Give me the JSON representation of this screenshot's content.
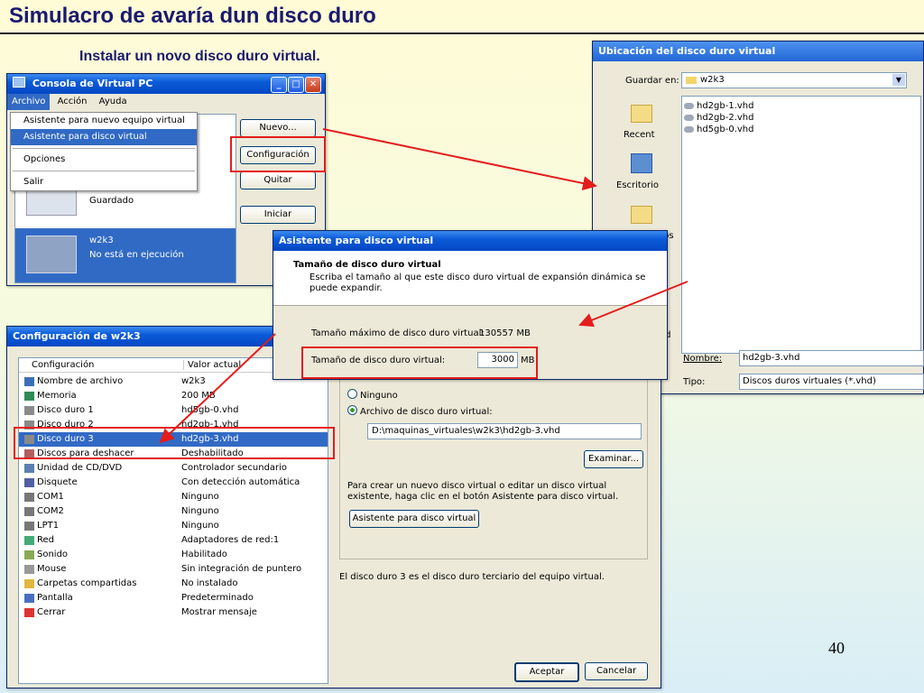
{
  "slide": {
    "title": "Simulacro de avaría dun disco duro",
    "subtitle": "Instalar un novo disco duro virtual.",
    "page_number": "40"
  },
  "console": {
    "title": "Consola de Virtual PC",
    "menu": [
      "Archivo",
      "Acción",
      "Ayuda"
    ],
    "dropdown": [
      "Asistente para nuevo equipo virtual",
      "Asistente para disco virtual",
      "Opciones",
      "Salir"
    ],
    "buttons": {
      "new": "Nuevo...",
      "settings": "Configuración",
      "remove": "Quitar",
      "start": "Iniciar"
    },
    "vm1_status": "Guardado",
    "vm2_name": "w2k3",
    "vm2_status": "No está en ejecución"
  },
  "save_dialog": {
    "title": "Ubicación del disco duro virtual",
    "save_in_label": "Guardar en:",
    "save_in_value": "w2k3",
    "places": [
      "Recent",
      "Escritorio",
      "ntos"
    ],
    "files": [
      "hd2gb-1.vhd",
      "hd2gb-2.vhd",
      "hd5gb-0.vhd"
    ],
    "name_label": "Nombre:",
    "name_value": "hd2gb-3.vhd",
    "type_label": "Tipo:",
    "type_value": "Discos duros virtuales (*.vhd)",
    "edge_fragment": "ed"
  },
  "wizard": {
    "title": "Asistente para disco virtual",
    "heading": "Tamaño de disco duro virtual",
    "description": "Escriba el tamaño al que este disco duro virtual de expansión dinámica se puede expandir.",
    "max_size_label": "Tamaño máximo de disco duro virtual:",
    "max_size_value": "130557 MB",
    "size_label": "Tamaño de disco duro virtual:",
    "size_value": "3000",
    "size_unit": "MB"
  },
  "config": {
    "title": "Configuración de w2k3",
    "col_setting": "Configuración",
    "col_value": "Valor actual",
    "rows": [
      {
        "k": "Nombre de archivo",
        "v": "w2k3"
      },
      {
        "k": "Memoria",
        "v": "200 MB"
      },
      {
        "k": "Disco duro 1",
        "v": "hd5gb-0.vhd"
      },
      {
        "k": "Disco duro 2",
        "v": "hd2gb-1.vhd"
      },
      {
        "k": "Disco duro 3",
        "v": "hd2gb-3.vhd"
      },
      {
        "k": "Discos para deshacer",
        "v": "Deshabilitado"
      },
      {
        "k": "Unidad de CD/DVD",
        "v": "Controlador secundario"
      },
      {
        "k": "Disquete",
        "v": "Con detección automática"
      },
      {
        "k": "COM1",
        "v": "Ninguno"
      },
      {
        "k": "COM2",
        "v": "Ninguno"
      },
      {
        "k": "LPT1",
        "v": "Ninguno"
      },
      {
        "k": "Red",
        "v": "Adaptadores de red:1"
      },
      {
        "k": "Sonido",
        "v": "Habilitado"
      },
      {
        "k": "Mouse",
        "v": "Sin integración de puntero"
      },
      {
        "k": "Carpetas compartidas",
        "v": "No instalado"
      },
      {
        "k": "Pantalla",
        "v": "Predeterminado"
      },
      {
        "k": "Cerrar",
        "v": "Mostrar mensaje"
      }
    ],
    "selected_index": 4,
    "option_none": "Ninguno",
    "option_file": "Archivo de disco duro virtual:",
    "file_path": "D:\\maquinas_virtuales\\w2k3\\hd2gb-3.vhd",
    "browse": "Examinar...",
    "help_text": "Para crear un nuevo disco virtual o editar un disco virtual existente, haga clic en el botón Asistente para disco virtual.",
    "wizard_button": "Asistente para disco virtual",
    "info_text": "El disco duro 3 es el disco duro terciario del equipo virtual.",
    "ok": "Aceptar",
    "cancel": "Cancelar"
  },
  "colors": {
    "highlight": "#316ac5",
    "annotation_red": "#e41c1c",
    "title_blue": "#1a1a6e"
  }
}
